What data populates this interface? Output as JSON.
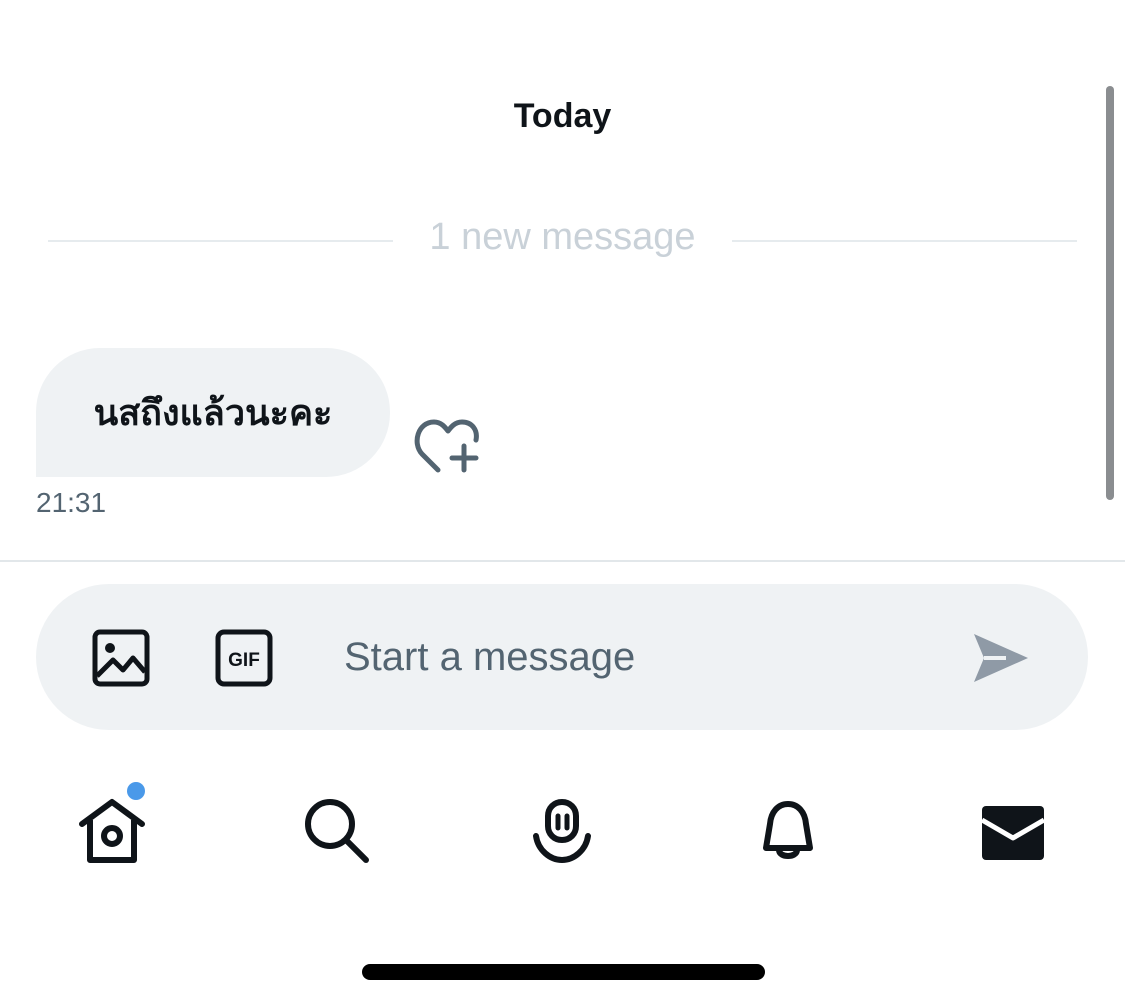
{
  "conversation": {
    "date_header": "Today",
    "new_messages_label": "1 new message",
    "messages": [
      {
        "text": "นสถึงแล้วนะคะ",
        "time": "21:31"
      }
    ]
  },
  "composer": {
    "placeholder": "Start a message",
    "image_icon": "image-icon",
    "gif_icon": "gif-icon",
    "gif_text": "GIF",
    "send_icon": "send-icon"
  },
  "bottom_nav": {
    "items": [
      {
        "icon": "home-icon",
        "has_notification_dot": true
      },
      {
        "icon": "search-icon"
      },
      {
        "icon": "spaces-icon"
      },
      {
        "icon": "bell-icon"
      },
      {
        "icon": "mail-icon",
        "active": true
      }
    ]
  },
  "colors": {
    "accent": "#4a99e9",
    "bubble": "#eff2f4",
    "muted_text": "#536471",
    "divider_text": "#c9d1d8"
  }
}
